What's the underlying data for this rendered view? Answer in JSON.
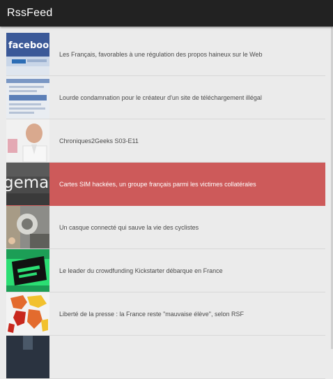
{
  "app": {
    "title": "RssFeed"
  },
  "feed": {
    "items": [
      {
        "title": "Les Français, favorables à une régulation des propos haineux sur le Web",
        "thumb": "facebook-logo-thumbnail",
        "thumb_text": "facebook",
        "selected": false
      },
      {
        "title": "Lourde condamnation pour le créateur d'un site de téléchargement illégal",
        "thumb": "website-screenshot-thumbnail",
        "selected": false
      },
      {
        "title": "Chroniques2Geeks S03-E11",
        "thumb": "person-portrait-thumbnail",
        "selected": false
      },
      {
        "title": "Cartes SIM hackées, un groupe français parmi les victimes collatérales",
        "thumb": "gemalto-sign-thumbnail",
        "thumb_text": "gemal",
        "selected": true
      },
      {
        "title": "Un casque connecté qui sauve la vie des cyclistes",
        "thumb": "cyclist-helmet-thumbnail",
        "selected": false
      },
      {
        "title": "Le leader du crowdfunding Kickstarter débarque en France",
        "thumb": "kickstarter-thumbnail",
        "selected": false
      },
      {
        "title": "Liberté de la presse : la France reste \"mauvaise élève\", selon RSF",
        "thumb": "press-freedom-map-thumbnail",
        "selected": false
      }
    ]
  },
  "colors": {
    "action_bar": "#222222",
    "background": "#ebebeb",
    "selected": "#cd5a5a"
  }
}
